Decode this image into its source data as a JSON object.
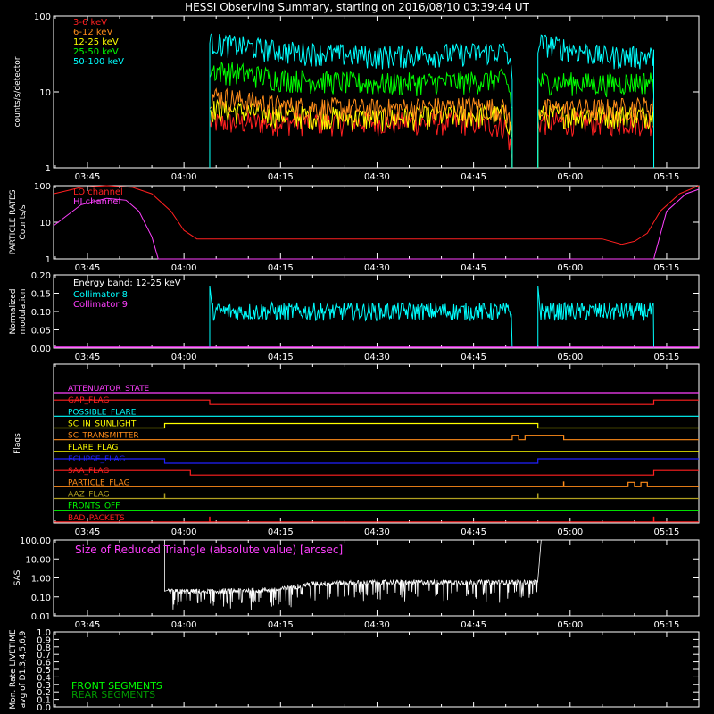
{
  "title": "HESSI Observing Summary, starting on 2016/08/10 03:39:44 UT",
  "time_axis": {
    "start": "03:39:44",
    "end": "05:20",
    "ticks": [
      "03:45",
      "04:00",
      "04:15",
      "04:30",
      "04:45",
      "05:00",
      "05:15"
    ]
  },
  "chart_data": [
    {
      "type": "line",
      "ylabel": "counts/s/detector",
      "yscale": "log",
      "ylim": [
        1,
        100
      ],
      "yticks": [
        "1",
        "10",
        "100"
      ],
      "observation_windows": [
        [
          "04:04",
          "04:51"
        ],
        [
          "04:55",
          "05:13"
        ]
      ],
      "series": [
        {
          "name": "3-6 keV",
          "color": "#ff2020",
          "points": [
            [
              "04:04",
              4
            ],
            [
              "04:15",
              4
            ],
            [
              "04:30",
              4
            ],
            [
              "04:45",
              4
            ],
            [
              "04:50",
              3.5
            ],
            [
              "04:51",
              1.2
            ],
            [
              "04:55",
              4
            ],
            [
              "05:05",
              4
            ],
            [
              "05:13",
              4
            ]
          ]
        },
        {
          "name": "6-12 keV",
          "color": "#ff8c1a",
          "points": [
            [
              "04:04",
              9
            ],
            [
              "04:15",
              6.5
            ],
            [
              "04:30",
              6
            ],
            [
              "04:45",
              6.5
            ],
            [
              "04:50",
              6
            ],
            [
              "04:51",
              2.5
            ],
            [
              "04:55",
              6
            ],
            [
              "05:05",
              6
            ],
            [
              "05:13",
              6.5
            ]
          ]
        },
        {
          "name": "12-25 keV",
          "color": "#ffff00",
          "points": [
            [
              "04:04",
              6
            ],
            [
              "04:15",
              5
            ],
            [
              "04:30",
              4.5
            ],
            [
              "04:45",
              5
            ],
            [
              "04:50",
              5
            ],
            [
              "04:51",
              2.5
            ],
            [
              "04:55",
              5
            ],
            [
              "05:05",
              5
            ],
            [
              "05:13",
              5
            ]
          ]
        },
        {
          "name": "25-50 keV",
          "color": "#00ff00",
          "points": [
            [
              "04:04",
              20
            ],
            [
              "04:15",
              15
            ],
            [
              "04:30",
              13
            ],
            [
              "04:45",
              14
            ],
            [
              "04:50",
              15
            ],
            [
              "04:51",
              6
            ],
            [
              "04:55",
              14
            ],
            [
              "05:05",
              13
            ],
            [
              "05:13",
              14
            ]
          ]
        },
        {
          "name": "50-100 keV",
          "color": "#00ffff",
          "points": [
            [
              "04:04",
              45
            ],
            [
              "04:15",
              35
            ],
            [
              "04:30",
              30
            ],
            [
              "04:45",
              33
            ],
            [
              "04:50",
              35
            ],
            [
              "04:51",
              15
            ],
            [
              "04:55",
              45
            ],
            [
              "05:05",
              30
            ],
            [
              "05:13",
              30
            ]
          ]
        }
      ]
    },
    {
      "type": "line",
      "ylabel": "PARTICLE RATES Counts/s",
      "yscale": "log",
      "ylim": [
        1,
        100
      ],
      "yticks": [
        "1",
        "10",
        "100"
      ],
      "series": [
        {
          "name": "LO channel",
          "color": "#ff2020",
          "points": [
            [
              "03:39:44",
              60
            ],
            [
              "03:44",
              90
            ],
            [
              "03:48",
              100
            ],
            [
              "03:52",
              90
            ],
            [
              "03:55",
              60
            ],
            [
              "03:58",
              20
            ],
            [
              "04:00",
              6
            ],
            [
              "04:02",
              3.5
            ],
            [
              "04:15",
              3.5
            ],
            [
              "04:30",
              3.5
            ],
            [
              "04:45",
              3.5
            ],
            [
              "05:00",
              3.5
            ],
            [
              "05:05",
              3.5
            ],
            [
              "05:08",
              2.5
            ],
            [
              "05:10",
              3
            ],
            [
              "05:12",
              5
            ],
            [
              "05:14",
              20
            ],
            [
              "05:17",
              60
            ],
            [
              "05:20",
              100
            ]
          ]
        },
        {
          "name": "HI channel",
          "color": "#ff40ff",
          "points": [
            [
              "03:39:44",
              8
            ],
            [
              "03:44",
              30
            ],
            [
              "03:48",
              45
            ],
            [
              "03:51",
              40
            ],
            [
              "03:53",
              20
            ],
            [
              "03:55",
              4
            ],
            [
              "03:56",
              1
            ],
            [
              "05:13",
              1
            ],
            [
              "05:15",
              20
            ],
            [
              "05:18",
              60
            ],
            [
              "05:20",
              80
            ]
          ]
        }
      ]
    },
    {
      "type": "line",
      "ylabel": "Normalized modulation",
      "ylim": [
        0,
        0.2
      ],
      "yticks": [
        "0.00",
        "0.05",
        "0.10",
        "0.15",
        "0.20"
      ],
      "annotation": "Energy band: 12-25 keV",
      "series": [
        {
          "name": "Collimator 8",
          "color": "#00ffff",
          "level": 0.1,
          "windows": [
            [
              "04:04",
              "04:51"
            ],
            [
              "04:55",
              "05:13"
            ]
          ]
        },
        {
          "name": "Collimator 9",
          "color": "#ff40ff",
          "level": 0.0
        }
      ]
    },
    {
      "type": "table",
      "ylabel": "Flags",
      "flags": [
        {
          "name": "ATTENUATOR_STATE",
          "color": "#ff40ff",
          "transitions": [],
          "start": 0
        },
        {
          "name": "GAP_FLAG",
          "color": "#ff2020",
          "transitions": [
            "04:04",
            "05:13"
          ],
          "start": 1
        },
        {
          "name": "POSSIBLE_FLARE",
          "color": "#00ffff",
          "transitions": [],
          "start": 0
        },
        {
          "name": "SC_IN_SUNLIGHT",
          "color": "#ffff00",
          "transitions": [
            "03:57",
            "04:55"
          ],
          "start": 0
        },
        {
          "name": "SC_TRANSMITTER",
          "color": "#ff8c1a",
          "transitions": [
            "04:51",
            "04:52",
            "04:53",
            "04:59"
          ],
          "start": 0
        },
        {
          "name": "FLARE_FLAG",
          "color": "#ffff00",
          "transitions": [],
          "start": 0
        },
        {
          "name": "ECLIPSE_FLAG",
          "color": "#2020ff",
          "transitions": [
            "03:57",
            "04:55"
          ],
          "start": 1
        },
        {
          "name": "SAA_FLAG",
          "color": "#ff2020",
          "transitions": [
            "04:01",
            "05:13"
          ],
          "start": 1
        },
        {
          "name": "PARTICLE_FLAG",
          "color": "#ff8c1a",
          "transitions": [
            "05:09",
            "05:10",
            "05:11",
            "05:12"
          ],
          "start": 0,
          "spikes": [
            "04:59"
          ]
        },
        {
          "name": "AAZ_FLAG",
          "color": "#b0a020",
          "transitions": [],
          "start": 0,
          "spikes": [
            "03:57",
            "04:55"
          ]
        },
        {
          "name": "FRONTS_OFF",
          "color": "#00ff00",
          "transitions": [],
          "start": 0
        },
        {
          "name": "BAD_PACKETS",
          "color": "#ff2020",
          "transitions": [],
          "start": 0,
          "spikes": [
            "04:04",
            "05:13"
          ]
        }
      ]
    },
    {
      "type": "line",
      "ylabel": "SAS",
      "yscale": "log",
      "ylim": [
        0.01,
        100
      ],
      "yticks": [
        "0.01",
        "0.10",
        "1.00",
        "10.00",
        "100.00"
      ],
      "annotation": "Size of Reduced Triangle (absolute value) [arcsec]",
      "series": [
        {
          "name": "Size of Reduced Triangle",
          "color": "#ffffff",
          "points": [
            [
              "03:57",
              100
            ],
            [
              "03:57:30",
              0.2
            ],
            [
              "04:05",
              0.2
            ],
            [
              "04:15",
              0.25
            ],
            [
              "04:20",
              0.5
            ],
            [
              "04:30",
              0.6
            ],
            [
              "04:45",
              0.6
            ],
            [
              "04:55",
              0.6
            ],
            [
              "04:55:30",
              100
            ]
          ]
        }
      ]
    },
    {
      "type": "line",
      "ylabel": "Mon. Rate LIVETIME avg of D1,3,4,5,6,9",
      "ylim": [
        0,
        1.0
      ],
      "yticks": [
        "0.0",
        "0.1",
        "0.2",
        "0.3",
        "0.4",
        "0.5",
        "0.6",
        "0.7",
        "0.8",
        "0.9",
        "1.0"
      ],
      "series": [
        {
          "name": "FRONT SEGMENTS",
          "color": "#00ff00",
          "points": []
        },
        {
          "name": "REAR SEGMENTS",
          "color": "#009900",
          "points": []
        }
      ]
    }
  ]
}
